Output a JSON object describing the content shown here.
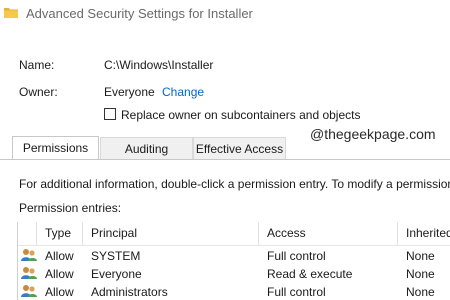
{
  "window": {
    "title": "Advanced Security Settings for Installer"
  },
  "details": {
    "name_label": "Name:",
    "name_value": "C:\\Windows\\Installer",
    "owner_label": "Owner:",
    "owner_value": "Everyone",
    "change_link": "Change",
    "replace_owner_label": "Replace owner on subcontainers and objects",
    "replace_owner_checked": false
  },
  "watermark": "@thegeekpage.com",
  "tabs": [
    {
      "label": "Permissions",
      "active": true
    },
    {
      "label": "Auditing",
      "active": false
    },
    {
      "label": "Effective Access",
      "active": false
    }
  ],
  "info_text": "For additional information, double-click a permission entry. To modify a permission",
  "entries_label": "Permission entries:",
  "table": {
    "columns": [
      "Type",
      "Principal",
      "Access",
      "Inherited"
    ],
    "rows": [
      {
        "type": "Allow",
        "principal": "SYSTEM",
        "access": "Full control",
        "inherited": "None",
        "icon": "users-icon"
      },
      {
        "type": "Allow",
        "principal": "Everyone",
        "access": "Read & execute",
        "inherited": "None",
        "icon": "users-icon"
      },
      {
        "type": "Allow",
        "principal": "Administrators",
        "access": "Full control",
        "inherited": "None",
        "icon": "users-icon"
      }
    ]
  },
  "colors": {
    "link": "#0066cc",
    "tab_inactive": "#f0f0f0",
    "folder": "#e8b23a"
  }
}
